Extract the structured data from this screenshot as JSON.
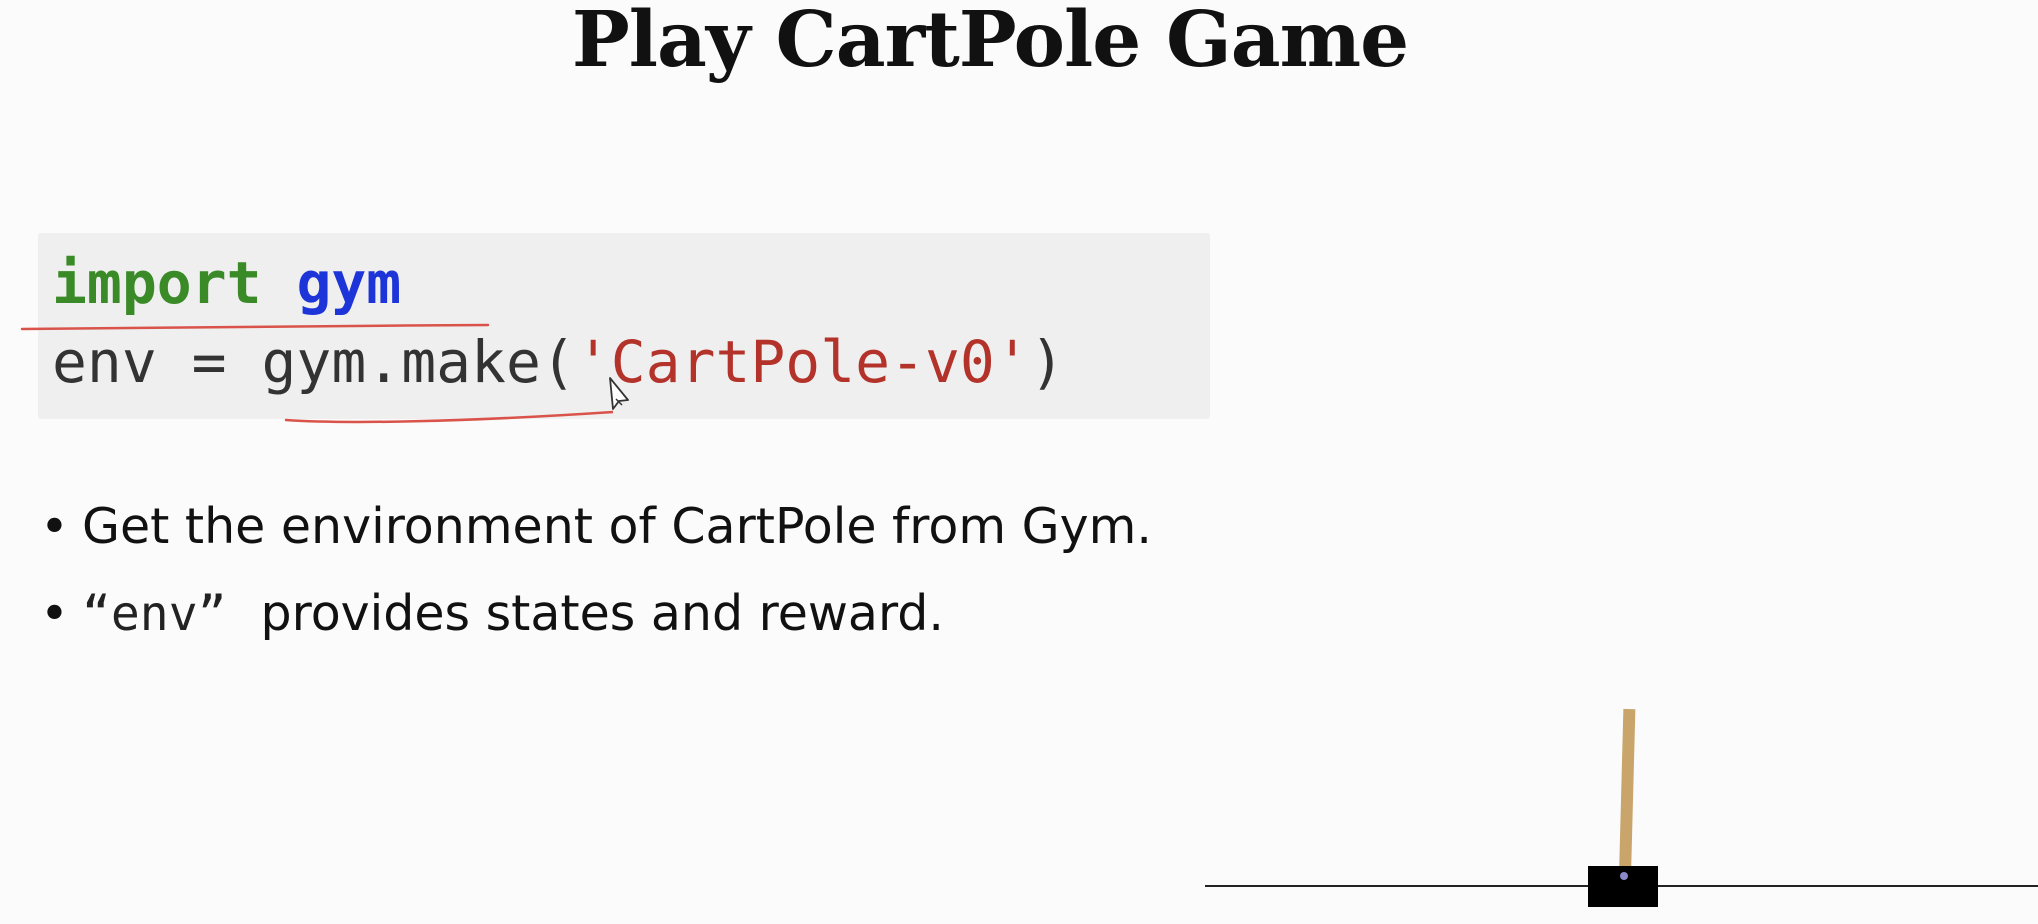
{
  "slide": {
    "title": "Play CartPole Game"
  },
  "code": {
    "line1": {
      "keyword": "import",
      "space": " ",
      "module": "gym"
    },
    "line2": {
      "prefix": "env = gym.make(",
      "string": "'CartPole-v0'",
      "suffix": ")"
    }
  },
  "bullets": {
    "marker": "•",
    "item1": "Get the environment of CartPole from Gym.",
    "item2": {
      "open_quote": "“",
      "code": "env",
      "close_quote": "”",
      "text": "provides states and reward."
    }
  },
  "colors": {
    "background": "#fbfbfb",
    "code_background": "#efefef",
    "keyword_green": "#3a8a27",
    "module_blue": "#1d35d8",
    "string_red": "#b3332a",
    "annotation_red": "#d9534a",
    "pole": "#c9a46b",
    "cart": "#000000"
  },
  "icons": {
    "cursor": "pen-cursor-icon",
    "render": "cartpole-environment"
  }
}
